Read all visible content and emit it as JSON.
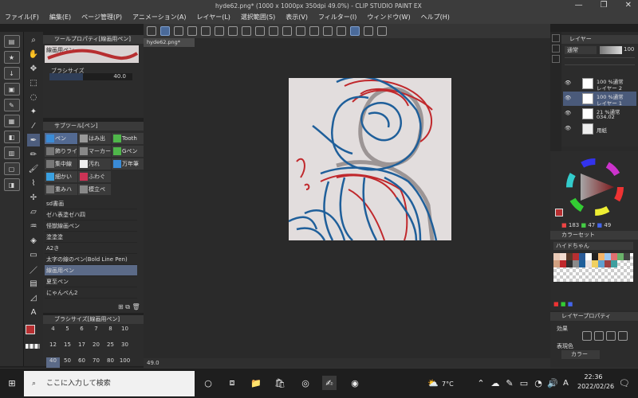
{
  "window": {
    "title": "hyde62.png* (1000 x 1000px 350dpi 49.0%) - CLIP STUDIO PAINT EX",
    "controls": [
      "—",
      "❐",
      "✕"
    ]
  },
  "menu": [
    "ファイル(F)",
    "編集(E)",
    "ページ管理(P)",
    "アニメーション(A)",
    "レイヤー(L)",
    "選択範囲(S)",
    "表示(V)",
    "フィルター(I)",
    "ウィンドウ(W)",
    "ヘルプ(H)"
  ],
  "tool_property": {
    "title": "ツールプロパティ[線画用ペン]",
    "preview": "線画用ペン",
    "brush_size_label": "ブラシサイズ",
    "brush_size_value": "40.0"
  },
  "sub_tool": {
    "title": "サブツール[ペン]",
    "tabs": [
      [
        "ペン",
        "はみ出",
        "Tooth"
      ],
      [
        "飾りライ",
        "マーカー",
        "Gペン"
      ],
      [
        "集中線",
        "汚れ",
        "万年筆"
      ],
      [
        "細かい",
        "ふわぐ",
        ""
      ],
      [
        "重みハ",
        "模立ペ",
        ""
      ]
    ],
    "items": [
      "sd書画",
      "ゼハ表塗ゼハ四",
      "怪獣線画ペン",
      "塗塗塗",
      "A2き",
      "太字の線のペン(Bold Line Pen)",
      "線画用ペン",
      "夏至ペン",
      "にゃんぺん2"
    ]
  },
  "brush_size_panel": {
    "title": "ブラシサイズ[線画用ペン]",
    "sizes": [
      "4",
      "5",
      "6",
      "7",
      "8",
      "10",
      "12",
      "15",
      "17",
      "20",
      "25",
      "30",
      "40",
      "50",
      "60",
      "70",
      "80",
      "100"
    ]
  },
  "canvas": {
    "tab": "hyde62.png*",
    "zoom": "49.0",
    "colors": {
      "bg": "#e2dddd",
      "blue": "#1f5f9a",
      "red": "#c0282c",
      "grey": "#9c9595"
    }
  },
  "layers": {
    "title": "レイヤー",
    "blend": "通常",
    "opacity": "100",
    "rows": [
      {
        "pct": "100 %通常",
        "name": "レイヤー 2"
      },
      {
        "pct": "100 %通常",
        "name": "レイヤー 1"
      },
      {
        "pct": "21 %通常",
        "name": "034.02"
      },
      {
        "pct": "",
        "name": "用紙"
      }
    ]
  },
  "color": {
    "r": "183",
    "g": "47",
    "b": "49",
    "main": "#b72f31"
  },
  "color_set": {
    "title": "カラーセット",
    "name": "ハイドちゃん"
  },
  "layer_property": {
    "title": "レイヤープロパティ",
    "effect_label": "効果",
    "expression_label": "表現色",
    "expression_value": "カラー"
  },
  "taskbar": {
    "search_placeholder": "ここに入力して検索",
    "weather": "7°C",
    "ime": "A",
    "time": "22:36",
    "date": "2022/02/26"
  }
}
